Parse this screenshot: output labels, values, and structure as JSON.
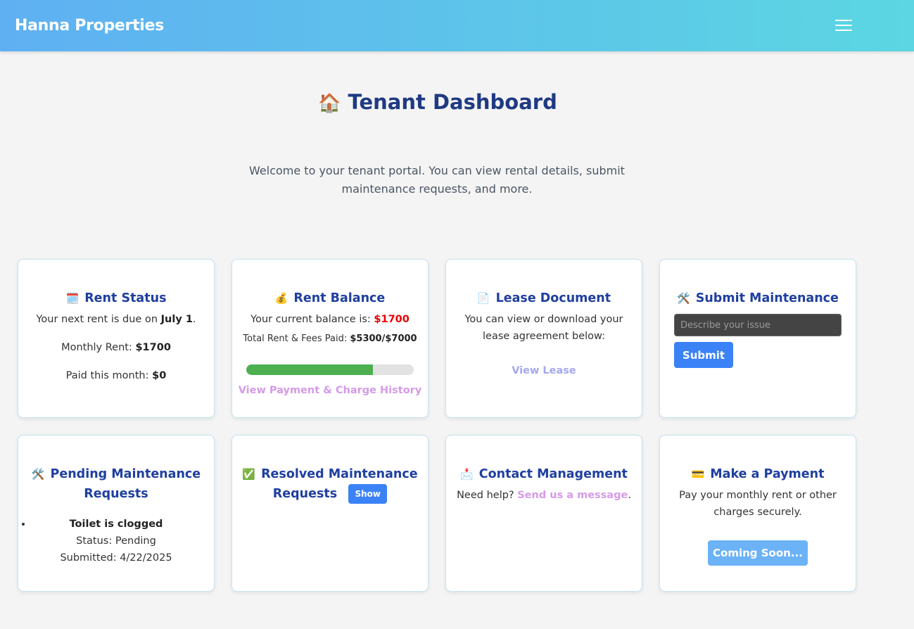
{
  "header": {
    "brand": "Hanna Properties",
    "menu_icon": "hamburger-icon"
  },
  "page": {
    "title": "Tenant Dashboard",
    "title_icon": "🏠",
    "intro": "Welcome to your tenant portal. You can view rental details, submit maintenance requests, and more."
  },
  "rent_status": {
    "icon": "🗓️",
    "title": "Rent Status",
    "due_prefix": "Your next rent is due on ",
    "due_date": "July 1",
    "due_suffix": ".",
    "monthly_label": "Monthly Rent: ",
    "monthly_value": "$1700",
    "paid_label": "Paid this month: ",
    "paid_value": "$0"
  },
  "rent_balance": {
    "icon": "💰",
    "title": "Rent Balance",
    "balance_label": "Your current balance is: ",
    "balance_value": "$1700",
    "total_label": "Total Rent & Fees Paid: ",
    "total_value": "$5300/$7000",
    "progress_fraction": 0.757,
    "history_link": "View Payment & Charge History"
  },
  "lease": {
    "icon": "📄",
    "title": "Lease Document",
    "text": "You can view or download your lease agreement below:",
    "link": "View Lease"
  },
  "submit_maintenance": {
    "icon": "🛠️",
    "title": "Submit Maintenance",
    "placeholder": "Describe your issue",
    "button": "Submit"
  },
  "pending": {
    "icon": "🛠️",
    "title": "Pending Maintenance Requests",
    "items": [
      {
        "title": "Toilet is clogged",
        "status": "Status: Pending",
        "submitted": "Submitted: 4/22/2025"
      }
    ]
  },
  "resolved": {
    "icon": "✅",
    "title_line1": "Resolved Maintenance",
    "title_line2": "Requests",
    "show_button": "Show"
  },
  "contact": {
    "icon": "📩",
    "title": "Contact Management",
    "help": "Need help? ",
    "link": "Send us a message",
    "suffix": "."
  },
  "payment": {
    "icon": "💳",
    "title": "Make a Payment",
    "text": "Pay your monthly rent or other charges securely.",
    "button": "Coming Soon..."
  }
}
